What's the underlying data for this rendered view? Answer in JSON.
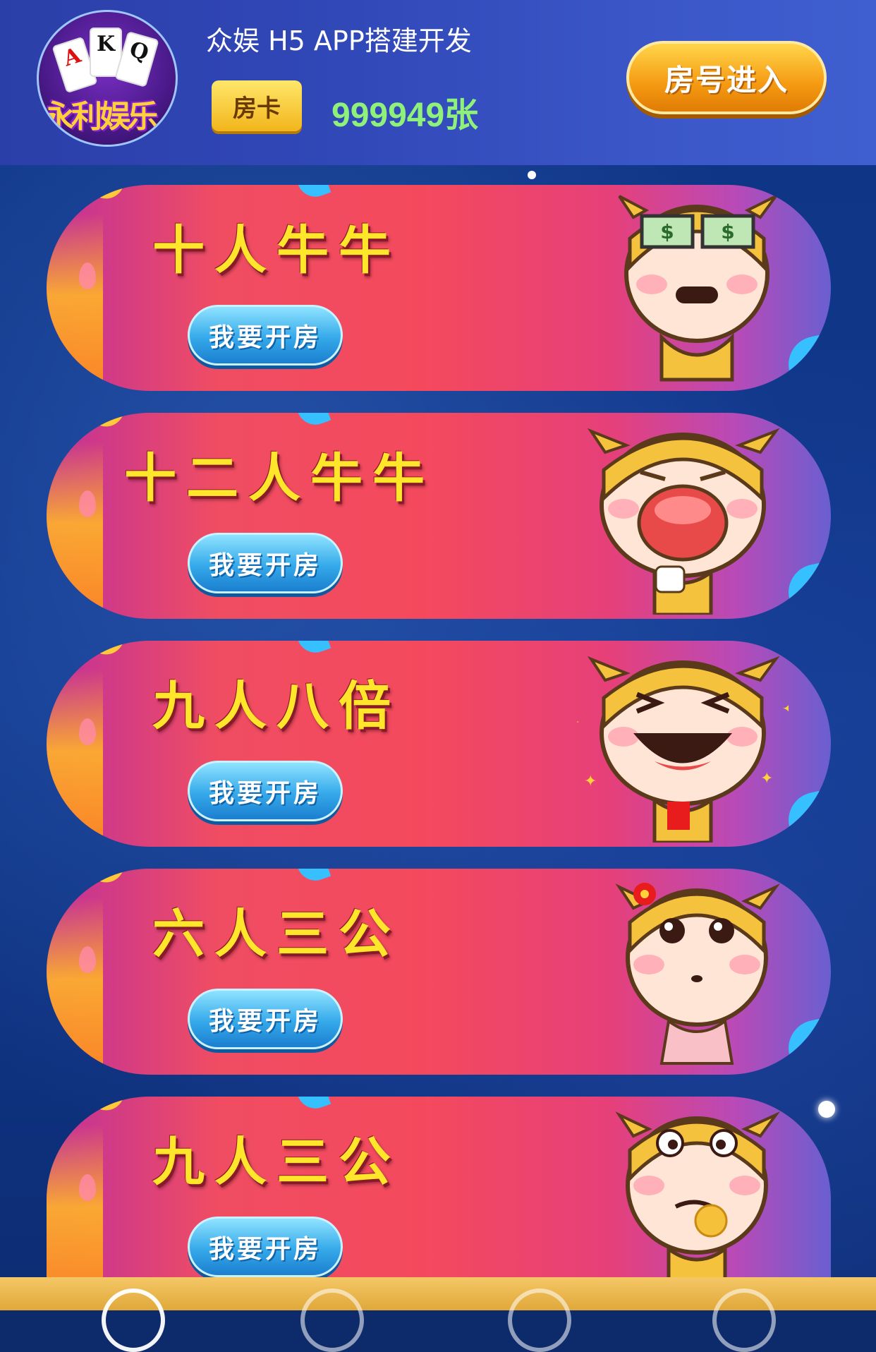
{
  "header": {
    "app_title": "众娱 H5 APP搭建开发",
    "fangka_label": "房卡",
    "card_count": "999949张",
    "enter_room_label": "房号进入",
    "avatar_logo_text": "永利娱乐",
    "avatar_cards": [
      "A",
      "K",
      "Q"
    ]
  },
  "games": [
    {
      "title": "十人牛牛",
      "button": "我要开房",
      "mascot": "money-eyes-cow"
    },
    {
      "title": "十二人牛牛",
      "button": "我要开房",
      "mascot": "crying-cow"
    },
    {
      "title": "九人八倍",
      "button": "我要开房",
      "mascot": "laughing-cow"
    },
    {
      "title": "六人三公",
      "button": "我要开房",
      "mascot": "shy-cow"
    },
    {
      "title": "九人三公",
      "button": "我要开房",
      "mascot": "coin-cow"
    }
  ],
  "colors": {
    "header_bg": "#3148b8",
    "title_yellow": "#ffe62a",
    "count_green": "#8ff07a",
    "button_blue": "#35a9ea",
    "enter_orange": "#f59a12",
    "bottom_bar": "#e0a83a"
  }
}
